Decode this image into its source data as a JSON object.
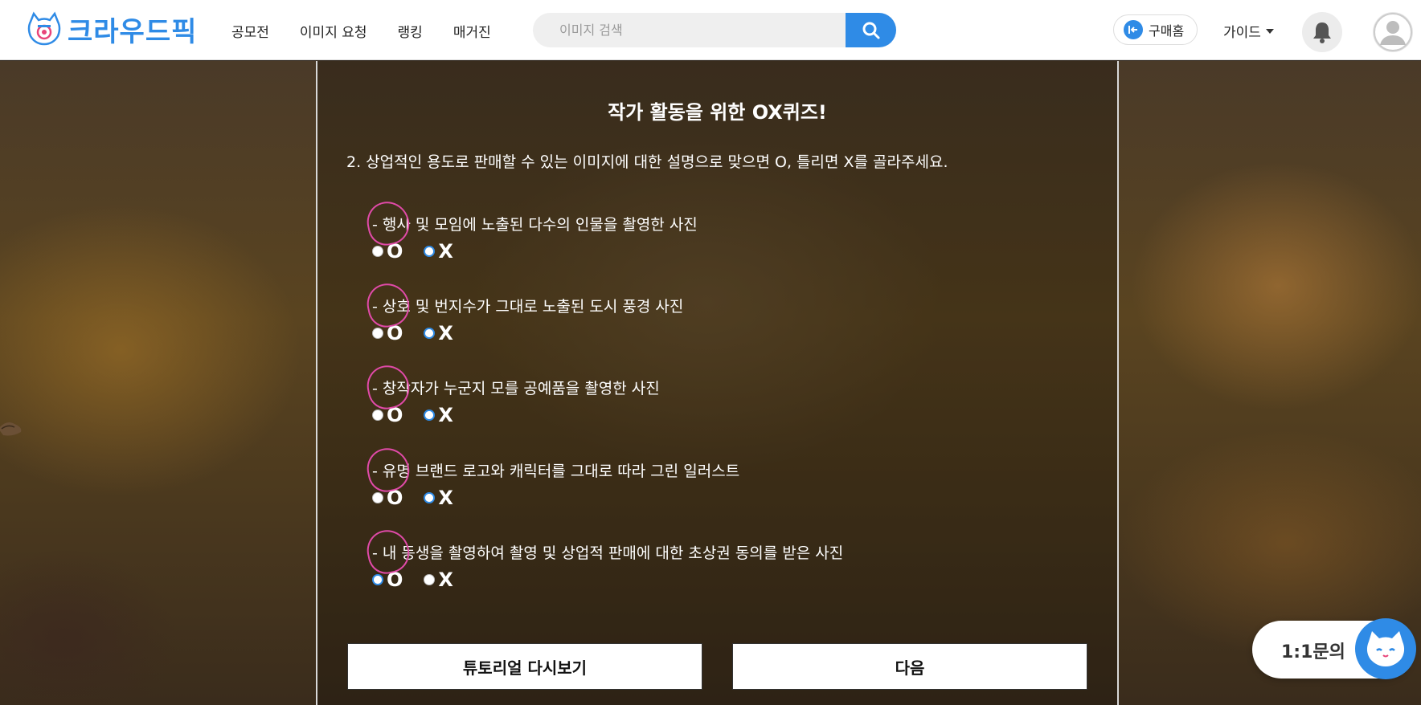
{
  "header": {
    "logo_text": "크라우드픽",
    "nav": [
      "공모전",
      "이미지 요청",
      "랭킹",
      "매거진"
    ],
    "search_placeholder": "이미지 검색",
    "buy_home_label": "구매홈",
    "guide_label": "가이드"
  },
  "quiz": {
    "title": "작가 활동을 위한 OX퀴즈!",
    "question": "2. 상업적인 용도로 판매할 수 있는 이미지에 대한 설명으로 맞으면 O, 틀리면 X를 골라주세요.",
    "items": [
      {
        "text": "- 행사 및 모임에 노출된 다수의 인물을 촬영한 사진",
        "selected": "X"
      },
      {
        "text": "- 상호 및 번지수가 그대로 노출된 도시 풍경 사진",
        "selected": "X"
      },
      {
        "text": "- 창작자가 누군지 모를 공예품을 촬영한 사진",
        "selected": "X"
      },
      {
        "text": "- 유명 브랜드 로고와 캐릭터를 그대로 따라 그린 일러스트",
        "selected": "X"
      },
      {
        "text": "- 내 동생을 촬영하여 촬영 및 상업적 판매에 대한 초상권 동의를 받은 사진",
        "selected": "O"
      }
    ],
    "option_o": "O",
    "option_x": "X",
    "tutorial_button": "튜토리얼 다시보기",
    "next_button": "다음"
  },
  "inquiry": {
    "label": "1:1문의"
  },
  "colors": {
    "accent": "#2f8be6",
    "annotation": "#e04aa8"
  }
}
